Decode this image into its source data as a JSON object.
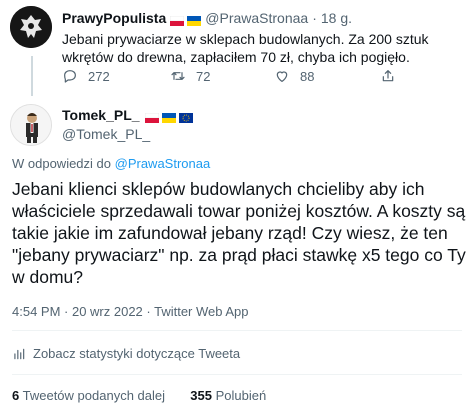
{
  "parent_tweet": {
    "author_name": "PrawyPopulista",
    "handle": "@PrawaStronaa",
    "separator": "·",
    "time": "18 g.",
    "text": "Jebani prywaciarze w sklepach budowlanych. Za 200 sztuk wkrętów do drewna, zapłaciłem 70 zł, chyba ich pogięło.",
    "reply_count": "272",
    "retweet_count": "72",
    "like_count": "88"
  },
  "main_tweet": {
    "author_name": "Tomek_PL_",
    "handle": "@Tomek_PL_",
    "reply_prefix": "W odpowiedzi do",
    "reply_target": "@PrawaStronaa",
    "text": "Jebani klienci sklepów budowlanych chcieliby aby ich właściciele sprzedawali towar poniżej kosztów. A koszty są takie jakie im zafundował jebany rząd! Czy wiesz, że ten \"jebany prywaciarz\" np. za prąd płaci stawkę x5 tego co Ty w domu?",
    "meta": "4:54 PM · 20 wrz 2022 · Twitter Web App",
    "stats_link": "Zobacz statystyki dotyczące Tweeta",
    "retweets_value": "6",
    "retweets_label": "Tweetów podanych dalej",
    "likes_value": "355",
    "likes_label": "Polubień"
  },
  "colors": {
    "accent": "#1d9bf0",
    "secondary_text": "#536471",
    "primary_text": "#0f1419",
    "divider": "#eff3f4"
  }
}
